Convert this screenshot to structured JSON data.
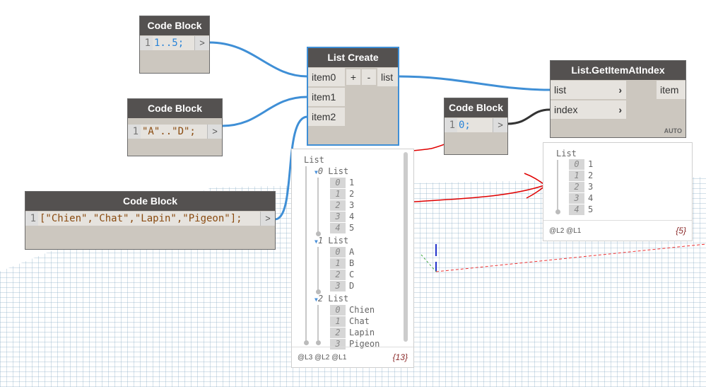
{
  "code_blocks": [
    {
      "title": "Code Block",
      "line": "1",
      "code": "1..5;",
      "out": ">"
    },
    {
      "title": "Code Block",
      "line": "1",
      "code": "\"A\"..\"D\";",
      "out": ">"
    },
    {
      "title": "Code Block",
      "line": "1",
      "code": "[\"Chien\",\"Chat\",\"Lapin\",\"Pigeon\"];",
      "out": ">"
    },
    {
      "title": "Code Block",
      "line": "1",
      "code": "0;",
      "out": ">"
    }
  ],
  "list_create": {
    "title": "List Create",
    "inputs": [
      "item0",
      "item1",
      "item2"
    ],
    "add": "+",
    "remove": "-",
    "output": "list"
  },
  "get_item": {
    "title": "List.GetItemAtIndex",
    "inputs": [
      "list",
      "index"
    ],
    "output": "item",
    "lacing": "AUTO"
  },
  "preview1": {
    "root": "List",
    "groups": [
      {
        "index": "0",
        "label": "List",
        "items": [
          [
            "0",
            "1"
          ],
          [
            "1",
            "2"
          ],
          [
            "2",
            "3"
          ],
          [
            "3",
            "4"
          ],
          [
            "4",
            "5"
          ]
        ]
      },
      {
        "index": "1",
        "label": "List",
        "items": [
          [
            "0",
            "A"
          ],
          [
            "1",
            "B"
          ],
          [
            "2",
            "C"
          ],
          [
            "3",
            "D"
          ]
        ]
      },
      {
        "index": "2",
        "label": "List",
        "items": [
          [
            "0",
            "Chien"
          ],
          [
            "1",
            "Chat"
          ],
          [
            "2",
            "Lapin"
          ],
          [
            "3",
            "Pigeon"
          ]
        ]
      }
    ],
    "levels": "@L3 @L2 @L1",
    "count": "{13}"
  },
  "preview2": {
    "root": "List",
    "items": [
      [
        "0",
        "1"
      ],
      [
        "1",
        "2"
      ],
      [
        "2",
        "3"
      ],
      [
        "3",
        "4"
      ],
      [
        "4",
        "5"
      ]
    ],
    "levels": "@L2 @L1",
    "count": "{5}"
  },
  "colors": {
    "wire": "#3f8fd6",
    "annotation": "#e00000",
    "header": "#545150"
  }
}
